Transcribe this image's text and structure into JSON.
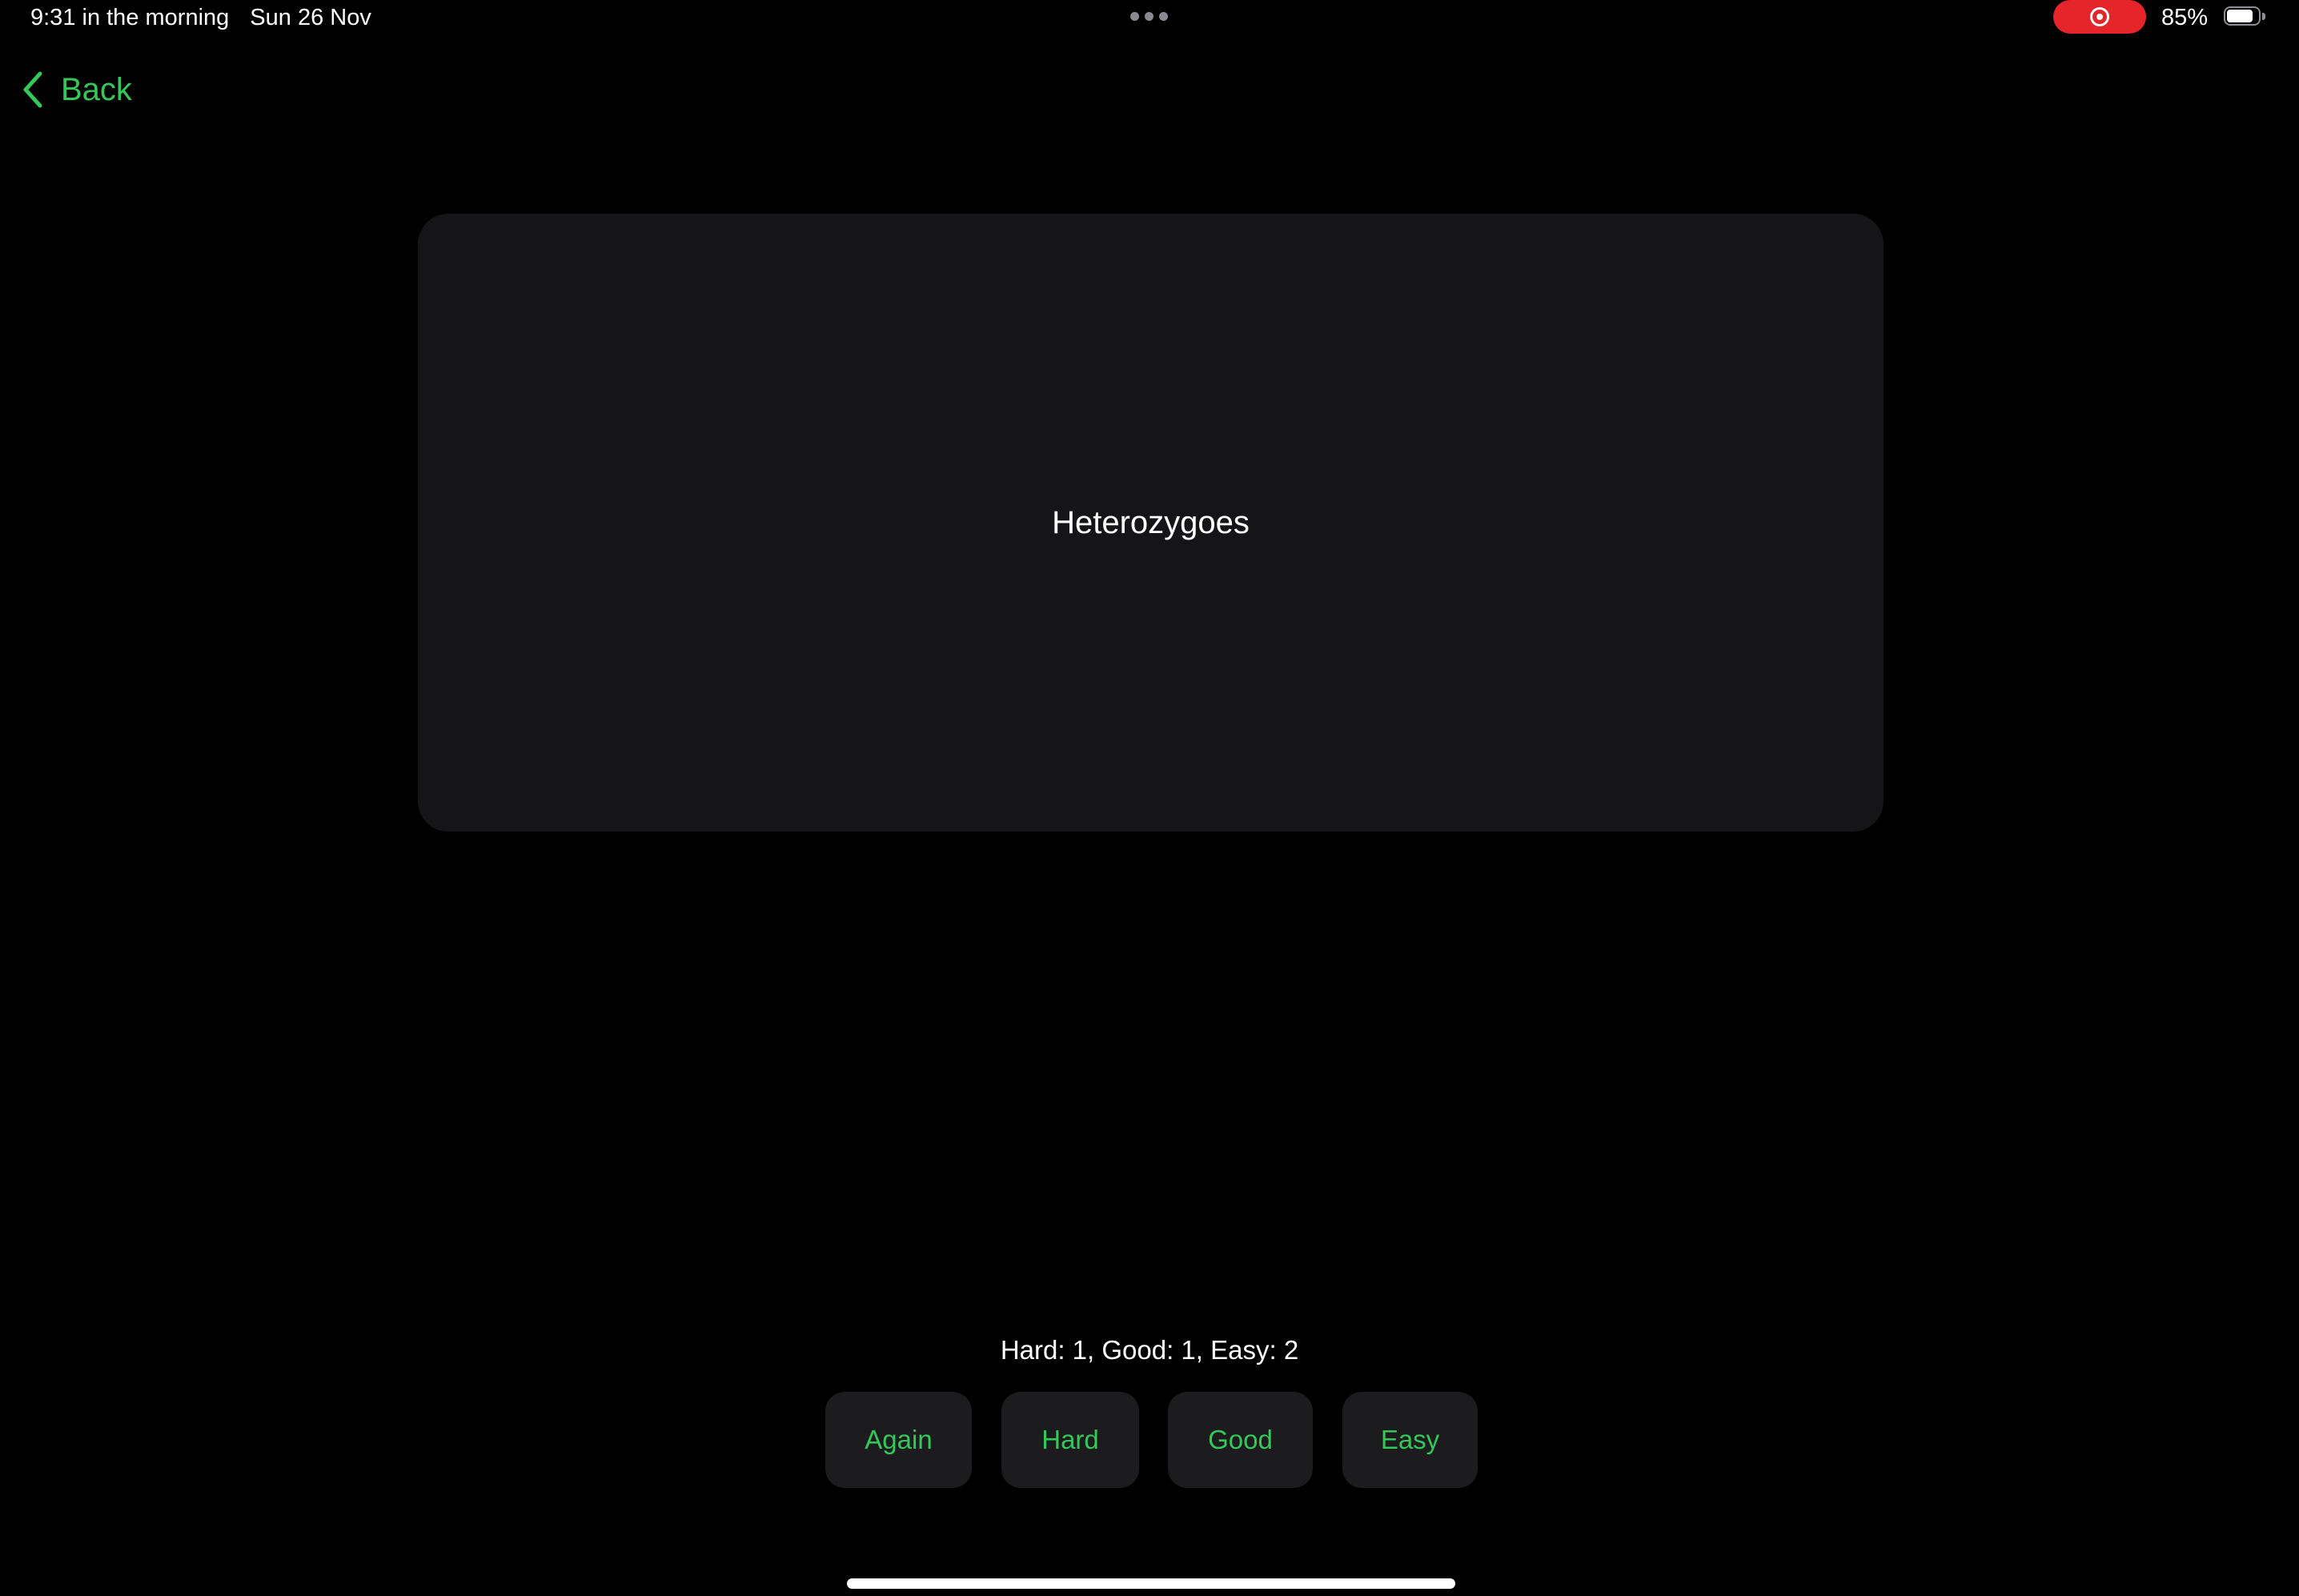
{
  "status_bar": {
    "time": "9:31 in the morning",
    "date": "Sun 26 Nov",
    "battery_percent": "85%",
    "battery_level": 0.85,
    "recording_color": "#e5252a"
  },
  "nav": {
    "back_label": "Back",
    "back_icon": "chevron-left-icon"
  },
  "card": {
    "text": "Heterozygoes"
  },
  "review": {
    "intervals_text": "Hard: 1, Good: 1, Easy: 2",
    "buttons": {
      "again": "Again",
      "hard": "Hard",
      "good": "Good",
      "easy": "Easy"
    }
  },
  "colors": {
    "accent": "#34c759",
    "background": "#000000",
    "card": "#151517",
    "button": "#1c1c1e"
  }
}
